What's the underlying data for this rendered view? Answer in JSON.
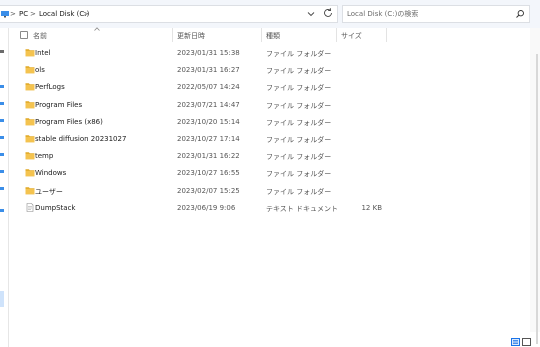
{
  "address_bar": {
    "crumbs": [
      "PC",
      "Local Disk (C:)"
    ],
    "separator": ">"
  },
  "search": {
    "placeholder": "Local Disk (C:)の検索"
  },
  "columns": {
    "name": "名前",
    "date": "更新日時",
    "type": "種類",
    "size": "サイズ"
  },
  "files": [
    {
      "name": "Intel",
      "date": "2023/01/31 15:38",
      "type": "ファイル フォルダー",
      "size": "",
      "icon": "folder-icon"
    },
    {
      "name": "ols",
      "date": "2023/01/31 16:27",
      "type": "ファイル フォルダー",
      "size": "",
      "icon": "folder-icon"
    },
    {
      "name": "PerfLogs",
      "date": "2022/05/07 14:24",
      "type": "ファイル フォルダー",
      "size": "",
      "icon": "folder-icon"
    },
    {
      "name": "Program Files",
      "date": "2023/07/21 14:47",
      "type": "ファイル フォルダー",
      "size": "",
      "icon": "folder-icon"
    },
    {
      "name": "Program Files (x86)",
      "date": "2023/10/20 15:14",
      "type": "ファイル フォルダー",
      "size": "",
      "icon": "folder-icon"
    },
    {
      "name": "stable diffusion 20231027",
      "date": "2023/10/27 17:14",
      "type": "ファイル フォルダー",
      "size": "",
      "icon": "folder-icon"
    },
    {
      "name": "temp",
      "date": "2023/01/31 16:22",
      "type": "ファイル フォルダー",
      "size": "",
      "icon": "folder-icon"
    },
    {
      "name": "Windows",
      "date": "2023/10/27 16:55",
      "type": "ファイル フォルダー",
      "size": "",
      "icon": "folder-icon"
    },
    {
      "name": "ユーザー",
      "date": "2023/02/07 15:25",
      "type": "ファイル フォルダー",
      "size": "",
      "icon": "folder-icon"
    },
    {
      "name": "DumpStack",
      "date": "2023/06/19 9:06",
      "type": "テキスト ドキュメント",
      "size": "12 KB",
      "icon": "text-file-icon"
    }
  ],
  "colors": {
    "folder": "#f4c34f",
    "folder_dark": "#e0a826",
    "selection": "#cfe3fb",
    "accent": "#1a73e8"
  }
}
